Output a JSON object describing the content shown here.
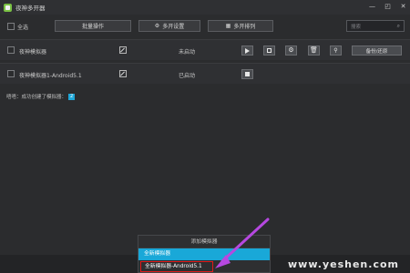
{
  "window": {
    "title": "夜神多开器",
    "controls": [
      "minimize-icon",
      "restore-icon",
      "close-icon"
    ]
  },
  "toolbar": {
    "select_all_label": "全选",
    "batch_label": "批量操作",
    "multi_settings_label": "多开设置",
    "multi_arrange_label": "多开排列",
    "search_placeholder": "搜索"
  },
  "rows": [
    {
      "name": "夜神模拟器",
      "status": "未启动",
      "actions": [
        "play-icon",
        "screenshot-icon",
        "settings-icon",
        "delete-icon",
        "shortcut-icon"
      ],
      "backup_label": "备份/还原"
    },
    {
      "name": "夜神模拟器1-Android5.1",
      "status": "已启动",
      "actions": [
        "stop-icon"
      ]
    }
  ],
  "status_message": {
    "text": "唔唔：成功创建了模拟器：",
    "count": "2"
  },
  "add_menu": {
    "header": "添加模拟器",
    "items": [
      "全新模拟器",
      "全新模拟器-Android5.1"
    ]
  },
  "watermark": {
    "text": "www.yeshen.com"
  },
  "colors": {
    "accent": "#19a8d8",
    "highlight_border": "#e01a1a",
    "arrow": "#b648e0",
    "background": "#2b2c2e"
  }
}
